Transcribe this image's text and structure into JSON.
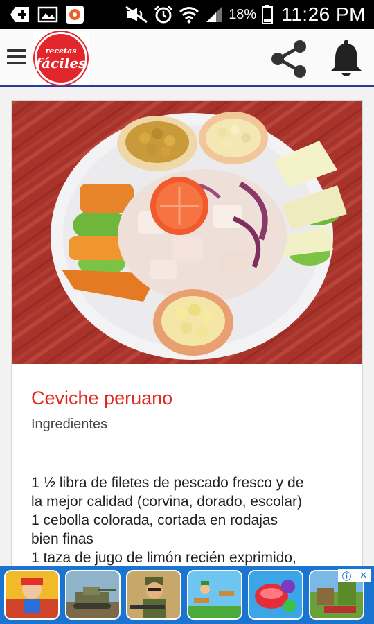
{
  "status_bar": {
    "battery_percent": "18%",
    "time": "11:26 PM",
    "icons": [
      "add-icon",
      "gallery-icon",
      "app-notification-icon",
      "mute-icon",
      "alarm-icon",
      "wifi-icon",
      "signal-icon",
      "battery-icon"
    ]
  },
  "app_bar": {
    "logo_text_top": "recetas",
    "logo_text_main": "fáciles",
    "icons": [
      "menu-icon",
      "share-icon",
      "bell-icon"
    ],
    "accent_color": "#2c3a9c",
    "brand_color": "#e3262b"
  },
  "recipe": {
    "title": "Ceviche peruano",
    "subtitle": "Ingredientes",
    "ingredient_lines": [
      "1 ½ libra de filetes de pescado fresco y de",
      "la mejor calidad (corvina, dorado, escolar)",
      "1 cebolla colorada, cortada en rodajas",
      "bien finas",
      "1 taza de jugo de limón recién exprimido,"
    ],
    "title_color": "#e02a20"
  },
  "ad_banner": {
    "tiles": [
      "subway-surfers-icon",
      "tank-game-icon",
      "soldier-game-icon",
      "platformer-game-icon",
      "candy-game-icon",
      "block-game-icon"
    ],
    "info_icon": "ad-info-icon",
    "close_icon": "ad-close-icon",
    "background_color": "#1b75d0"
  }
}
